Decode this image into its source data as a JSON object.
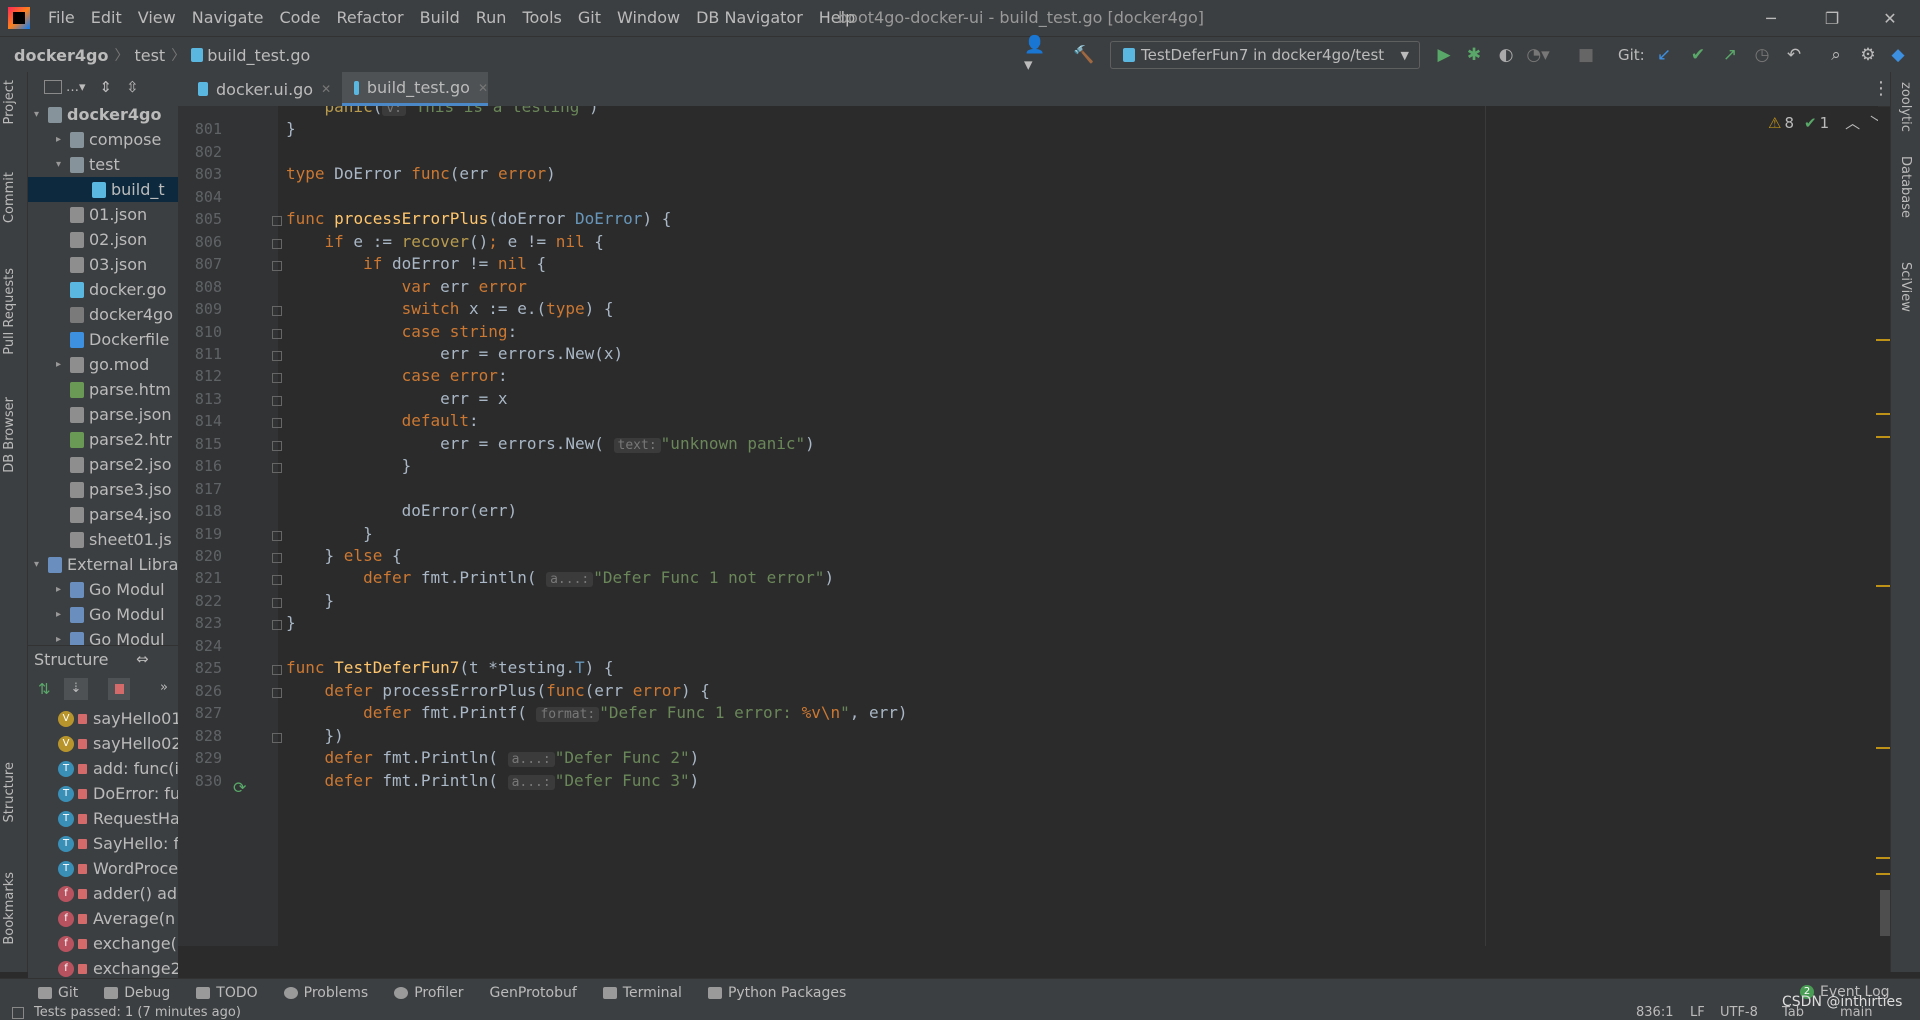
{
  "app": {
    "menu": [
      "File",
      "Edit",
      "View",
      "Navigate",
      "Code",
      "Refactor",
      "Build",
      "Run",
      "Tools",
      "Git",
      "Window",
      "DB Navigator",
      "Help"
    ],
    "window_title": "boot4go-docker-ui - build_test.go [docker4go]"
  },
  "navbar": {
    "crumbs": [
      "docker4go",
      "test",
      "build_test.go"
    ],
    "run_config": "TestDeferFun7 in docker4go/test",
    "git_label": "Git:"
  },
  "left_stripe": [
    "Project",
    "Commit",
    "Pull Requests",
    "DB Browser",
    "Structure",
    "Bookmarks"
  ],
  "right_stripe": [
    "zoolytic",
    "Database",
    "SciView"
  ],
  "project": {
    "tree": [
      {
        "label": "docker4go",
        "level": 0,
        "arrow": "▾",
        "bold": true,
        "icon": "folder"
      },
      {
        "label": "compose",
        "level": 1,
        "arrow": "▸",
        "icon": "folder"
      },
      {
        "label": "test",
        "level": 1,
        "arrow": "▾",
        "icon": "folder"
      },
      {
        "label": "build_t",
        "level": 2,
        "arrow": "",
        "icon": "go",
        "selected": true
      },
      {
        "label": "01.json",
        "level": 1,
        "arrow": "",
        "icon": "json"
      },
      {
        "label": "02.json",
        "level": 1,
        "arrow": "",
        "icon": "json"
      },
      {
        "label": "03.json",
        "level": 1,
        "arrow": "",
        "icon": "json"
      },
      {
        "label": "docker.go",
        "level": 1,
        "arrow": "",
        "icon": "go"
      },
      {
        "label": "docker4go",
        "level": 1,
        "arrow": "",
        "icon": "file"
      },
      {
        "label": "Dockerfile",
        "level": 1,
        "arrow": "",
        "icon": "docker"
      },
      {
        "label": "go.mod",
        "level": 1,
        "arrow": "▸",
        "icon": "mod"
      },
      {
        "label": "parse.htm",
        "level": 1,
        "arrow": "",
        "icon": "html"
      },
      {
        "label": "parse.json",
        "level": 1,
        "arrow": "",
        "icon": "json"
      },
      {
        "label": "parse2.htr",
        "level": 1,
        "arrow": "",
        "icon": "html"
      },
      {
        "label": "parse2.jso",
        "level": 1,
        "arrow": "",
        "icon": "json"
      },
      {
        "label": "parse3.jso",
        "level": 1,
        "arrow": "",
        "icon": "json"
      },
      {
        "label": "parse4.jso",
        "level": 1,
        "arrow": "",
        "icon": "json"
      },
      {
        "label": "sheet01.js",
        "level": 1,
        "arrow": "",
        "icon": "json"
      },
      {
        "label": "External Libra",
        "level": 0,
        "arrow": "▾",
        "icon": "lib"
      },
      {
        "label": "Go Modul",
        "level": 1,
        "arrow": "▸",
        "icon": "lib"
      },
      {
        "label": "Go Modul",
        "level": 1,
        "arrow": "▸",
        "icon": "lib"
      },
      {
        "label": "Go Modul",
        "level": 1,
        "arrow": "▸",
        "icon": "lib"
      }
    ]
  },
  "structure": {
    "title": "Structure",
    "items": [
      {
        "badge": "V",
        "color": "#b8952c",
        "label": "sayHello01"
      },
      {
        "badge": "V",
        "color": "#b8952c",
        "label": "sayHello02"
      },
      {
        "badge": "T",
        "color": "#3a8fb7",
        "label": "add: func(i"
      },
      {
        "badge": "T",
        "color": "#3a8fb7",
        "label": "DoError: fu"
      },
      {
        "badge": "T",
        "color": "#3a8fb7",
        "label": "RequestHa"
      },
      {
        "badge": "T",
        "color": "#3a8fb7",
        "label": "SayHello: f"
      },
      {
        "badge": "T",
        "color": "#3a8fb7",
        "label": "WordProce"
      },
      {
        "badge": "f",
        "color": "#b8525f",
        "label": "adder() ad"
      },
      {
        "badge": "f",
        "color": "#b8525f",
        "label": "Average(n"
      },
      {
        "badge": "f",
        "color": "#b8525f",
        "label": "exchange("
      },
      {
        "badge": "f",
        "color": "#b8525f",
        "label": "exchange2"
      }
    ]
  },
  "tabs": [
    {
      "label": "docker.ui.go",
      "active": false
    },
    {
      "label": "build_test.go",
      "active": true
    }
  ],
  "inspections": {
    "warnings": "8",
    "ok": "1"
  },
  "editor": {
    "lines": [
      {
        "n": "",
        "html": "    <span class=\"builtin\">panic</span>(<span class=\"hint\">v:</span><span class=\"st\">\"This is a testing\"</span>)"
      },
      {
        "n": "801",
        "html": "}"
      },
      {
        "n": "802",
        "html": ""
      },
      {
        "n": "803",
        "html": "<span class=\"kw\">type</span> DoError <span class=\"kw\">func</span>(err <span class=\"kw\">error</span>)"
      },
      {
        "n": "804",
        "html": ""
      },
      {
        "n": "805",
        "html": "<span class=\"kw\">func</span> <span class=\"fn\">processErrorPlus</span>(doError <span class=\"ty\">DoError</span>) {"
      },
      {
        "n": "806",
        "html": "    <span class=\"kw\">if</span> e := <span class=\"builtin\">recover</span>()<span class=\"kw\">;</span> e != <span class=\"kw\">nil</span> {"
      },
      {
        "n": "807",
        "html": "        <span class=\"kw\">if</span> doError != <span class=\"kw\">nil</span> {"
      },
      {
        "n": "808",
        "html": "            <span class=\"kw\">var</span> err <span class=\"kw\">error</span>"
      },
      {
        "n": "809",
        "html": "            <span class=\"kw\">switch</span> x := e.(<span class=\"kw\">type</span>) {"
      },
      {
        "n": "810",
        "html": "            <span class=\"kw\">case</span> <span class=\"kw\">string</span>:"
      },
      {
        "n": "811",
        "html": "                err = errors.<span class=\"call\">New</span>(x)"
      },
      {
        "n": "812",
        "html": "            <span class=\"kw\">case</span> <span class=\"kw\">error</span>:"
      },
      {
        "n": "813",
        "html": "                err = x"
      },
      {
        "n": "814",
        "html": "            <span class=\"kw\">default</span>:"
      },
      {
        "n": "815",
        "html": "                err = errors.<span class=\"call\">New</span>( <span class=\"hint\">text:</span><span class=\"st\">\"unknown panic\"</span>)"
      },
      {
        "n": "816",
        "html": "            }"
      },
      {
        "n": "817",
        "html": ""
      },
      {
        "n": "818",
        "html": "            doError(err)"
      },
      {
        "n": "819",
        "html": "        }"
      },
      {
        "n": "820",
        "html": "    } <span class=\"kw\">else</span> {"
      },
      {
        "n": "821",
        "html": "        <span class=\"kw\">defer</span> fmt.<span class=\"call\">Println</span>( <span class=\"hint\">a...:</span><span class=\"st\">\"Defer Func 1 not error\"</span>)"
      },
      {
        "n": "822",
        "html": "    }"
      },
      {
        "n": "823",
        "html": "}"
      },
      {
        "n": "824",
        "html": ""
      },
      {
        "n": "825",
        "html": "<span class=\"kw\">func</span> <span class=\"fn\">TestDeferFun7</span>(t *testing.<span class=\"ty\">T</span>) {"
      },
      {
        "n": "826",
        "html": "    <span class=\"kw\">defer</span> processErrorPlus(<span class=\"kw\">func</span>(err <span class=\"kw\">error</span>) {"
      },
      {
        "n": "827",
        "html": "        <span class=\"kw\">defer</span> fmt.<span class=\"call\">Printf</span>( <span class=\"hint\">format:</span><span class=\"st\">\"Defer Func 1 error: </span><span class=\"kw\">%v\\n</span><span class=\"st\">\"</span>, err)"
      },
      {
        "n": "828",
        "html": "    })"
      },
      {
        "n": "829",
        "html": "    <span class=\"kw\">defer</span> fmt.<span class=\"call\">Println</span>( <span class=\"hint\">a...:</span><span class=\"st\">\"Defer Func 2\"</span>)"
      },
      {
        "n": "830",
        "html": "    <span class=\"kw\">defer</span> fmt.<span class=\"call\">Println</span>( <span class=\"hint\">a...:</span><span class=\"st\">\"Defer Func 3\"</span>)"
      }
    ]
  },
  "bottom_tools": [
    "Git",
    "Debug",
    "TODO",
    "Problems",
    "Profiler",
    "GenProtobuf",
    "Terminal",
    "Python Packages"
  ],
  "event_log": {
    "count": "2",
    "label": "Event Log"
  },
  "status": {
    "left": "Tests passed: 1 (7 minutes ago)",
    "position": "836:1",
    "line_sep": "LF",
    "encoding": "UTF-8",
    "indent": "Tab",
    "branch": "main"
  },
  "watermark": "CSDN @inthirties"
}
